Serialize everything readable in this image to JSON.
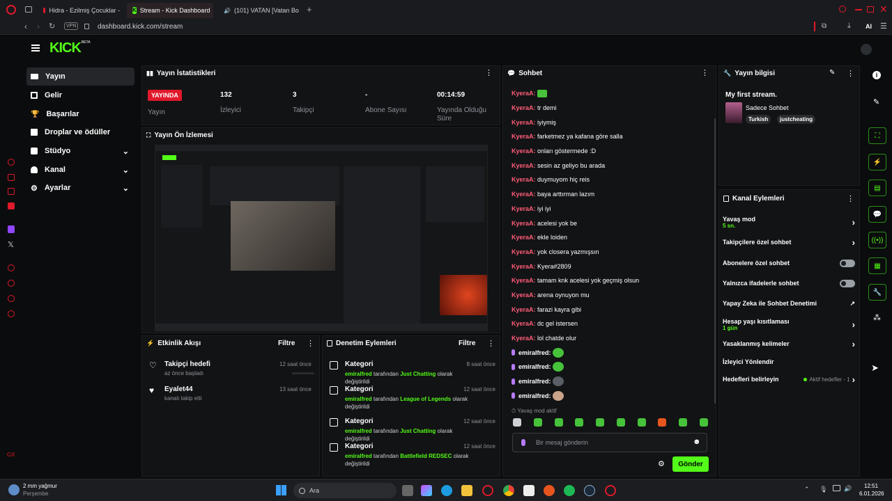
{
  "browser": {
    "tabs": [
      {
        "label": "Hidra - Ezilmiş Çocuklar -"
      },
      {
        "label": "Stream - Kick Dashboard"
      },
      {
        "label": "(101) VATAN [Vatan Bo"
      }
    ],
    "vpn": "VPN",
    "url": "dashboard.kick.com/stream",
    "ai": "AI"
  },
  "logo": {
    "text": "KICK",
    "beta": "BETA"
  },
  "nav": [
    {
      "label": "Yayın",
      "icon": "video-icon"
    },
    {
      "label": "Gelir",
      "icon": "chart-icon"
    },
    {
      "label": "Başarılar",
      "icon": "trophy-icon"
    },
    {
      "label": "Droplar ve ödüller",
      "icon": "gift-icon"
    },
    {
      "label": "Stüdyo",
      "icon": "studio-icon"
    },
    {
      "label": "Kanal",
      "icon": "user-icon"
    },
    {
      "label": "Ayarlar",
      "icon": "gear-icon"
    }
  ],
  "stats": {
    "title": "Yayın İstatistikleri",
    "live_badge": "YAYINDA",
    "live_label": "Yayın",
    "viewers_value": "132",
    "viewers_label": "İzleyici",
    "followers_value": "3",
    "followers_label": "Takipçi",
    "subs_value": "-",
    "subs_label": "Abone Sayısı",
    "time_value": "00:14:59",
    "time_label": "Yayında Olduğu Süre"
  },
  "preview": {
    "title": "Yayın Ön İzlemesi"
  },
  "activity": {
    "title": "Etkinlik Akışı",
    "filter": "Filtre",
    "items": [
      {
        "title": "Takipçi hedefi",
        "sub": "az önce başladı",
        "time": "12 saat önce"
      },
      {
        "title": "Eyalet44",
        "sub": "kanalı takip etti",
        "time": "13 saat önce"
      }
    ]
  },
  "moderation": {
    "title": "Denetim Eylemleri",
    "filter": "Filtre",
    "items": [
      {
        "title": "Kategori",
        "time": "8 saat önce",
        "user": "emiralfred",
        "mid": "tarafından",
        "cat": "Just Chatting",
        "end": "olarak değiştirildi"
      },
      {
        "title": "Kategori",
        "time": "12 saat önce",
        "user": "emiralfred",
        "mid": "tarafından",
        "cat": "League of Legends",
        "end": "olarak değiştirildi"
      },
      {
        "title": "Kategori",
        "time": "12 saat önce",
        "user": "emiralfred",
        "mid": "tarafından",
        "cat": "Just Chatting",
        "end": "olarak değiştirildi"
      },
      {
        "title": "Kategori",
        "time": "12 saat önce",
        "user": "emiralfred",
        "mid": "tarafından",
        "cat": "Battlefield REDSEC",
        "end": "olarak değiştirildi"
      }
    ]
  },
  "chat": {
    "title": "Sohbet",
    "messages": [
      {
        "user": "KyeraA",
        "text": ""
      },
      {
        "user": "KyeraA",
        "text": "tr demi"
      },
      {
        "user": "KyeraA",
        "text": "iyiymiş"
      },
      {
        "user": "KyeraA",
        "text": "farketmez ya kafana göre salla"
      },
      {
        "user": "KyeraA",
        "text": "onları göstermede :D"
      },
      {
        "user": "KyeraA",
        "text": "sesin az geliyo bu arada"
      },
      {
        "user": "KyeraA",
        "text": "duymuyom hiç reis"
      },
      {
        "user": "KyeraA",
        "text": "baya arttırman lazım"
      },
      {
        "user": "KyeraA",
        "text": "iyi iyi"
      },
      {
        "user": "KyeraA",
        "text": "acelesi yok be"
      },
      {
        "user": "KyeraA",
        "text": "ekle loiden"
      },
      {
        "user": "KyeraA",
        "text": "yok closera yazmışsın"
      },
      {
        "user": "KyeraA",
        "text": "Kyera#2809"
      },
      {
        "user": "KyeraA",
        "text": "tamam knk acelesi yok geçmiş olsun"
      },
      {
        "user": "KyeraA",
        "text": "arena oynuyon mu"
      },
      {
        "user": "KyeraA",
        "text": "farazi kayra gibi"
      },
      {
        "user": "KyeraA",
        "text": "dc gel istersen"
      },
      {
        "user": "KyeraA",
        "text": "lol chatde olur"
      },
      {
        "user": "emiralfred",
        "text": ""
      },
      {
        "user": "emiralfred",
        "text": ""
      },
      {
        "user": "emiralfred",
        "text": ""
      },
      {
        "user": "emiralfred",
        "text": ""
      }
    ],
    "slow_mode": "Yavaş mod aktif",
    "placeholder": "Bir mesaj gönderin",
    "send": "Gönder"
  },
  "stream_info": {
    "title": "Yayın bilgisi",
    "stream_title": "My first stream.",
    "category": "Sadece Sohbet",
    "tags": [
      "Turkish",
      "justcheating"
    ]
  },
  "channel_actions": {
    "title": "Kanal Eylemleri",
    "slow_mode": "Yavaş mod",
    "slow_mode_value": "5 sn.",
    "followers_only": "Takipçilere özel sohbet",
    "subs_only": "Abonelere özel sohbet",
    "emotes_only": "Yalnızca ifadelerle sohbet",
    "ai_mod": "Yapay Zeka ile Sohbet Denetimi",
    "account_age": "Hesap yaşı kısıtlaması",
    "account_age_value": "1 gün",
    "banned_words": "Yasaklanmış kelimeler",
    "raid": "İzleyici Yönlendir",
    "goals": "Hedefleri belirleyin",
    "goals_status": "Aktif hedefler - 1"
  },
  "taskbar": {
    "weather": "2 mm yağmur",
    "day": "Perşembe",
    "search": "Ara",
    "time": "12:51",
    "date": "6.01.2026"
  },
  "colors": {
    "accent": "#53fc18",
    "live": "#e0192b",
    "kyera": "#ff5d7a"
  }
}
